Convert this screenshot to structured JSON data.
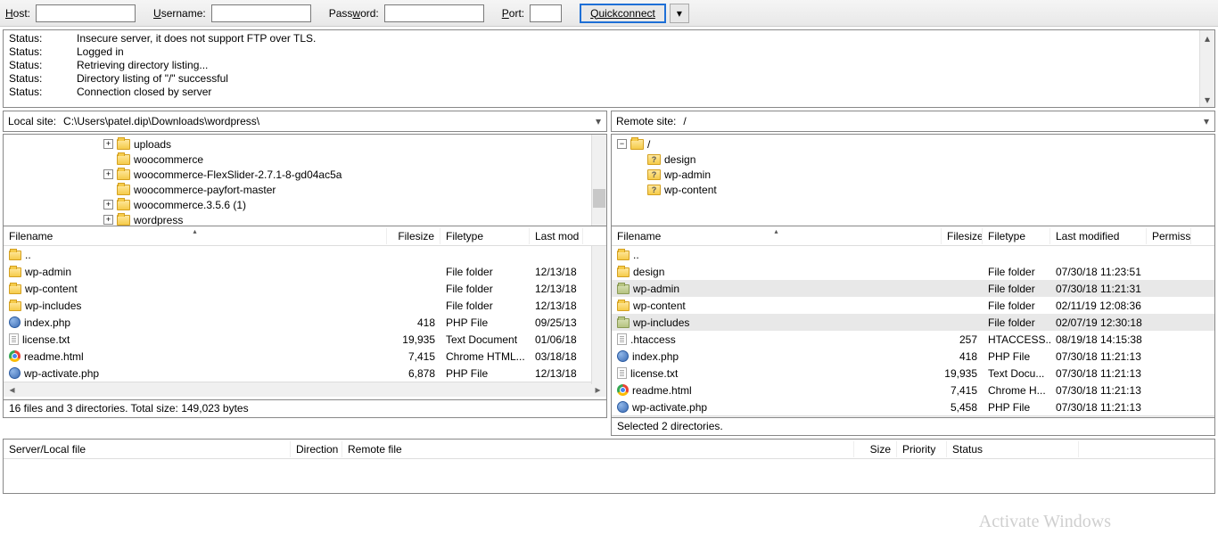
{
  "toolbar": {
    "host_label": "Host:",
    "user_label": "Username:",
    "pass_label": "Password:",
    "port_label": "Port:",
    "quickconnect": "Quickconnect"
  },
  "log": [
    {
      "label": "Status:",
      "msg": "Insecure server, it does not support FTP over TLS."
    },
    {
      "label": "Status:",
      "msg": "Logged in"
    },
    {
      "label": "Status:",
      "msg": "Retrieving directory listing..."
    },
    {
      "label": "Status:",
      "msg": "Directory listing of \"/\" successful"
    },
    {
      "label": "Status:",
      "msg": "Connection closed by server"
    }
  ],
  "local": {
    "site_label": "Local site:",
    "path": "C:\\Users\\patel.dip\\Downloads\\wordpress\\",
    "tree": [
      {
        "indent": 112,
        "exp": "+",
        "name": "uploads"
      },
      {
        "indent": 112,
        "exp": "",
        "name": "woocommerce"
      },
      {
        "indent": 112,
        "exp": "+",
        "name": "woocommerce-FlexSlider-2.7.1-8-gd04ac5a"
      },
      {
        "indent": 112,
        "exp": "",
        "name": "woocommerce-payfort-master"
      },
      {
        "indent": 112,
        "exp": "+",
        "name": "woocommerce.3.5.6 (1)"
      },
      {
        "indent": 112,
        "exp": "+",
        "name": "wordpress"
      }
    ],
    "headers": {
      "filename": "Filename",
      "filesize": "Filesize",
      "filetype": "Filetype",
      "lastmod": "Last mod"
    },
    "cols": {
      "filename": 430,
      "filesize": 60,
      "filetype": 100,
      "lastmod": 60
    },
    "files": [
      {
        "icon": "fld",
        "name": "..",
        "size": "",
        "type": "",
        "mod": ""
      },
      {
        "icon": "fld",
        "name": "wp-admin",
        "size": "",
        "type": "File folder",
        "mod": "12/13/18"
      },
      {
        "icon": "fld",
        "name": "wp-content",
        "size": "",
        "type": "File folder",
        "mod": "12/13/18"
      },
      {
        "icon": "fld",
        "name": "wp-includes",
        "size": "",
        "type": "File folder",
        "mod": "12/13/18"
      },
      {
        "icon": "php",
        "name": "index.php",
        "size": "418",
        "type": "PHP File",
        "mod": "09/25/13"
      },
      {
        "icon": "txt",
        "name": "license.txt",
        "size": "19,935",
        "type": "Text Document",
        "mod": "01/06/18"
      },
      {
        "icon": "chrome",
        "name": "readme.html",
        "size": "7,415",
        "type": "Chrome HTML...",
        "mod": "03/18/18"
      },
      {
        "icon": "php",
        "name": "wp-activate.php",
        "size": "6,878",
        "type": "PHP File",
        "mod": "12/13/18"
      }
    ],
    "status": "16 files and 3 directories. Total size: 149,023 bytes"
  },
  "remote": {
    "site_label": "Remote site:",
    "path": "/",
    "tree_root": "/",
    "tree_children": [
      "design",
      "wp-admin",
      "wp-content"
    ],
    "headers": {
      "filename": "Filename",
      "filesize": "Filesize",
      "filetype": "Filetype",
      "lastmod": "Last modified",
      "perm": "Permissic"
    },
    "cols": {
      "filename": 370,
      "filesize": 46,
      "filetype": 76,
      "lastmod": 108,
      "perm": 50
    },
    "files": [
      {
        "icon": "fld",
        "name": "..",
        "size": "",
        "type": "",
        "mod": "",
        "sel": false
      },
      {
        "icon": "fld",
        "name": "design",
        "size": "",
        "type": "File folder",
        "mod": "07/30/18 11:23:51",
        "sel": false
      },
      {
        "icon": "fldg",
        "name": "wp-admin",
        "size": "",
        "type": "File folder",
        "mod": "07/30/18 11:21:31",
        "sel": true
      },
      {
        "icon": "fld",
        "name": "wp-content",
        "size": "",
        "type": "File folder",
        "mod": "02/11/19 12:08:36",
        "sel": false
      },
      {
        "icon": "fldg",
        "name": "wp-includes",
        "size": "",
        "type": "File folder",
        "mod": "02/07/19 12:30:18",
        "sel": true
      },
      {
        "icon": "txt",
        "name": ".htaccess",
        "size": "257",
        "type": "HTACCESS...",
        "mod": "08/19/18 14:15:38",
        "sel": false
      },
      {
        "icon": "php",
        "name": "index.php",
        "size": "418",
        "type": "PHP File",
        "mod": "07/30/18 11:21:13",
        "sel": false
      },
      {
        "icon": "txt",
        "name": "license.txt",
        "size": "19,935",
        "type": "Text Docu...",
        "mod": "07/30/18 11:21:13",
        "sel": false
      },
      {
        "icon": "chrome",
        "name": "readme.html",
        "size": "7,415",
        "type": "Chrome H...",
        "mod": "07/30/18 11:21:13",
        "sel": false
      },
      {
        "icon": "php",
        "name": "wp-activate.php",
        "size": "5,458",
        "type": "PHP File",
        "mod": "07/30/18 11:21:13",
        "sel": false
      }
    ],
    "status": "Selected 2 directories."
  },
  "queue": {
    "headers": {
      "serverfile": "Server/Local file",
      "direction": "Direction",
      "remotefile": "Remote file",
      "size": "Size",
      "priority": "Priority",
      "status": "Status"
    }
  },
  "watermark": "Activate Windows"
}
